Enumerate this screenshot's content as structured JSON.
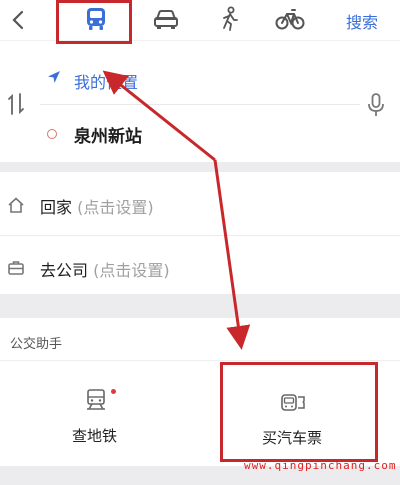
{
  "header": {
    "back_icon": "chevron-left-icon",
    "modes": [
      {
        "name": "bus",
        "icon": "bus-icon",
        "selected": true
      },
      {
        "name": "car",
        "icon": "car-icon",
        "selected": false
      },
      {
        "name": "walk",
        "icon": "walk-icon",
        "selected": false
      },
      {
        "name": "bike",
        "icon": "bike-icon",
        "selected": false
      }
    ],
    "search_label": "搜索"
  },
  "route": {
    "from_label": "我的位置",
    "to_label": "泉州新站"
  },
  "favorites": [
    {
      "label": "回家",
      "hint": "(点击设置)",
      "icon": "home-icon"
    },
    {
      "label": "去公司",
      "hint": "(点击设置)",
      "icon": "briefcase-icon"
    }
  ],
  "assistant": {
    "title": "公交助手",
    "tools": [
      {
        "label": "查地铁",
        "icon": "subway-icon",
        "has_notification": true
      },
      {
        "label": "买汽车票",
        "icon": "ticket-icon",
        "has_notification": false
      }
    ]
  },
  "watermark": "www.qingpinchang.com",
  "colors": {
    "accent": "#3b6fd8",
    "annotation_red": "#c8282b",
    "notification": "#e4393c"
  }
}
